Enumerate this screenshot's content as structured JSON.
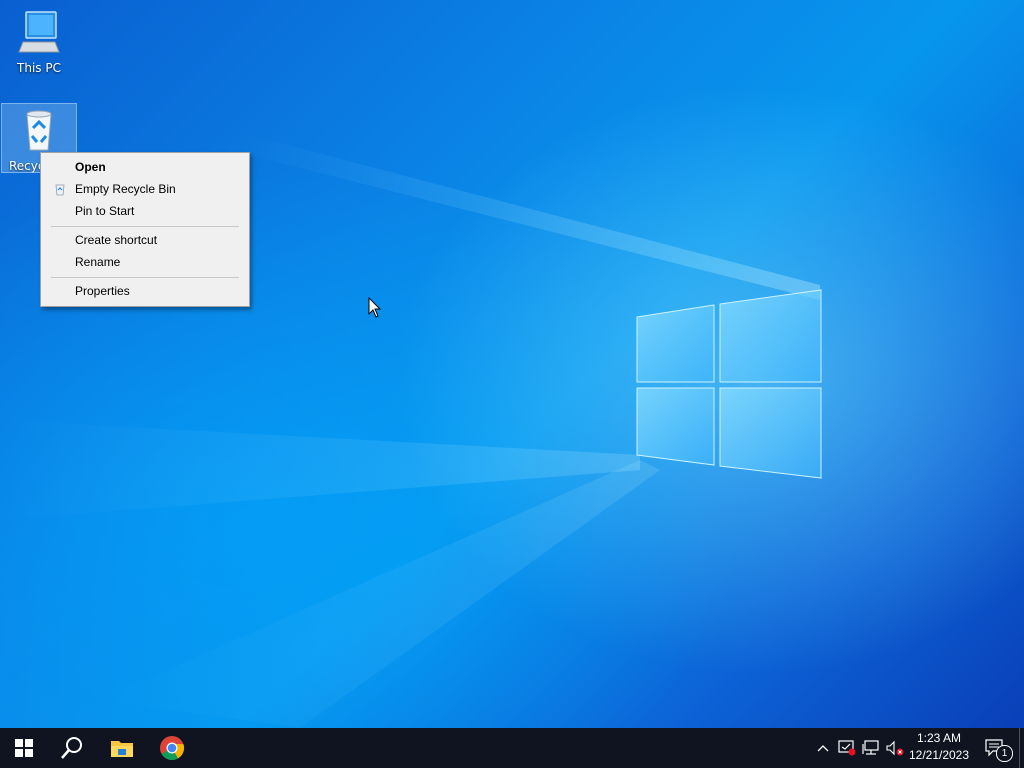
{
  "desktop": {
    "icons": [
      {
        "label": "This PC",
        "icon": "computer-icon"
      },
      {
        "label": "Recyc",
        "icon": "recycle-bin-icon"
      }
    ]
  },
  "context_menu": {
    "items": [
      {
        "label": "Open",
        "bold": true
      },
      {
        "label": "Empty Recycle Bin",
        "icon": "recycle-bin-small-icon"
      },
      {
        "label": "Pin to Start"
      },
      {
        "label": "Create shortcut"
      },
      {
        "label": "Rename"
      },
      {
        "label": "Properties"
      }
    ]
  },
  "taskbar": {
    "apps": [
      "start-icon",
      "search-icon",
      "file-explorer-icon",
      "chrome-icon"
    ],
    "clock": {
      "time": "1:23 AM",
      "date": "12/21/2023"
    },
    "notification_count": "1"
  },
  "colors": {
    "accent": "#0a84e6",
    "taskbar": "#0f1420",
    "menu_bg": "#f0f0f0"
  }
}
